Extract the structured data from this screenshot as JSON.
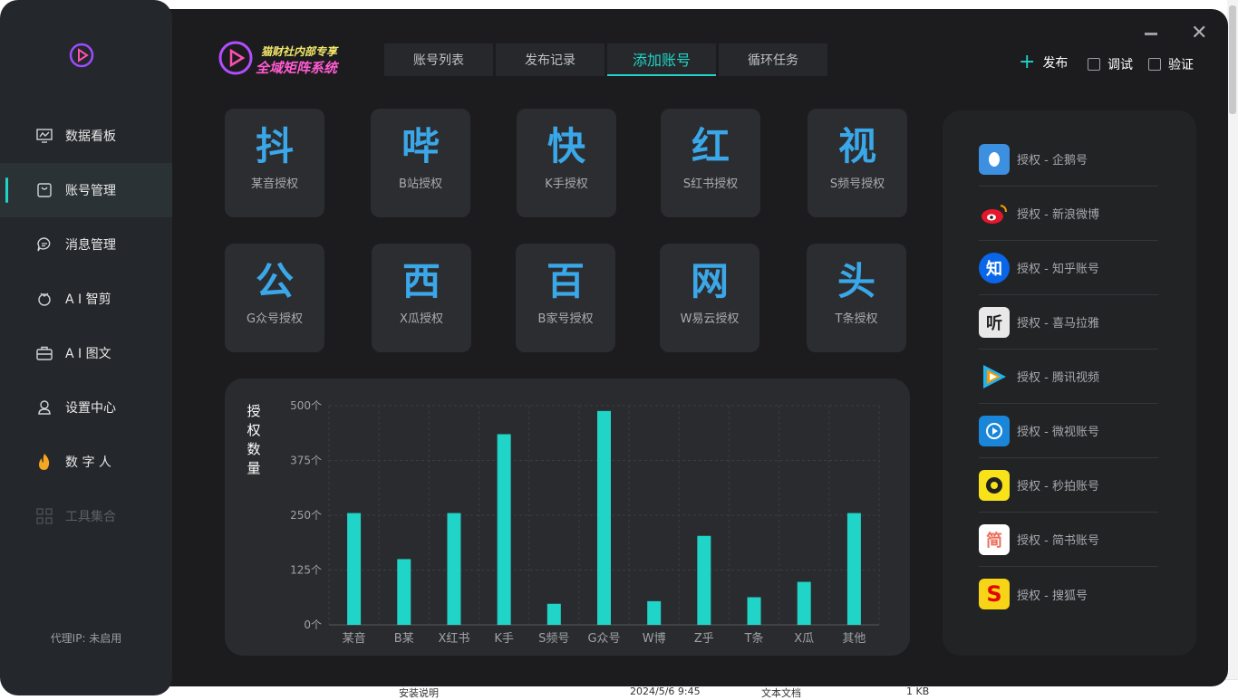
{
  "sidebar": {
    "items": [
      {
        "label": "数据看板",
        "icon": "dashboard-icon"
      },
      {
        "label": "账号管理",
        "icon": "account-icon"
      },
      {
        "label": "消息管理",
        "icon": "message-icon"
      },
      {
        "label": "A I 智剪",
        "icon": "ai-cut-icon"
      },
      {
        "label": "A I 图文",
        "icon": "ai-article-icon"
      },
      {
        "label": "设置中心",
        "icon": "settings-icon"
      },
      {
        "label": "数 字 人",
        "icon": "digital-human-icon"
      },
      {
        "label": "工具集合",
        "icon": "tools-icon"
      }
    ],
    "proxy": "代理IP: 未启用"
  },
  "brand": {
    "top": "猫财社内部专享",
    "main": "全域矩阵系统"
  },
  "tabs": [
    "账号列表",
    "发布记录",
    "添加账号",
    "循环任务"
  ],
  "toolbar": {
    "publish": "发布",
    "debug": "调试",
    "verify": "验证"
  },
  "platform_tiles": [
    {
      "char": "抖",
      "label": "某音授权"
    },
    {
      "char": "哔",
      "label": "B站授权"
    },
    {
      "char": "快",
      "label": "K手授权"
    },
    {
      "char": "红",
      "label": "S红书授权"
    },
    {
      "char": "视",
      "label": "S频号授权"
    },
    {
      "char": "公",
      "label": "G众号授权"
    },
    {
      "char": "西",
      "label": "X瓜授权"
    },
    {
      "char": "百",
      "label": "B家号授权"
    },
    {
      "char": "网",
      "label": "W易云授权"
    },
    {
      "char": "头",
      "label": "T条授权"
    }
  ],
  "auth_list": [
    {
      "label": "授权 - 企鹅号",
      "logo": "penguin-logo",
      "color": "#3d8fe0"
    },
    {
      "label": "授权 - 新浪微博",
      "logo": "weibo-logo",
      "color": "#e6162d"
    },
    {
      "label": "授权 - 知乎账号",
      "logo": "zhihu-logo",
      "color": "#0a66e8"
    },
    {
      "label": "授权 - 喜马拉雅",
      "logo": "ximalaya-logo",
      "color": "#e8e8e8"
    },
    {
      "label": "授权 - 腾讯视频",
      "logo": "tencent-video-logo",
      "color": "#1fb4f0"
    },
    {
      "label": "授权 - 微视账号",
      "logo": "weishi-logo",
      "color": "#1a86d9"
    },
    {
      "label": "授权 - 秒拍账号",
      "logo": "miaopai-logo",
      "color": "#f8e21a"
    },
    {
      "label": "授权 - 简书账号",
      "logo": "jianshu-logo",
      "color": "#ffffff"
    },
    {
      "label": "授权 - 搜狐号",
      "logo": "sohu-logo",
      "color": "#f7d417"
    }
  ],
  "chart_data": {
    "type": "bar",
    "ylabel": "授权数量",
    "categories": [
      "某音",
      "B某",
      "X红书",
      "K手",
      "S频号",
      "G众号",
      "W博",
      "Z乎",
      "T条",
      "X瓜",
      "其他"
    ],
    "values": [
      255,
      150,
      255,
      435,
      48,
      488,
      54,
      203,
      63,
      98,
      255
    ],
    "yticks": [
      "0个",
      "125个",
      "250个",
      "375个",
      "500个"
    ],
    "ylim": [
      0,
      500
    ],
    "grid": true,
    "bar_color": "#21d4c8"
  },
  "desktop": {
    "filename": "安装说明",
    "date": "2024/5/6 9:45",
    "type": "文本文档",
    "size": "1 KB"
  }
}
